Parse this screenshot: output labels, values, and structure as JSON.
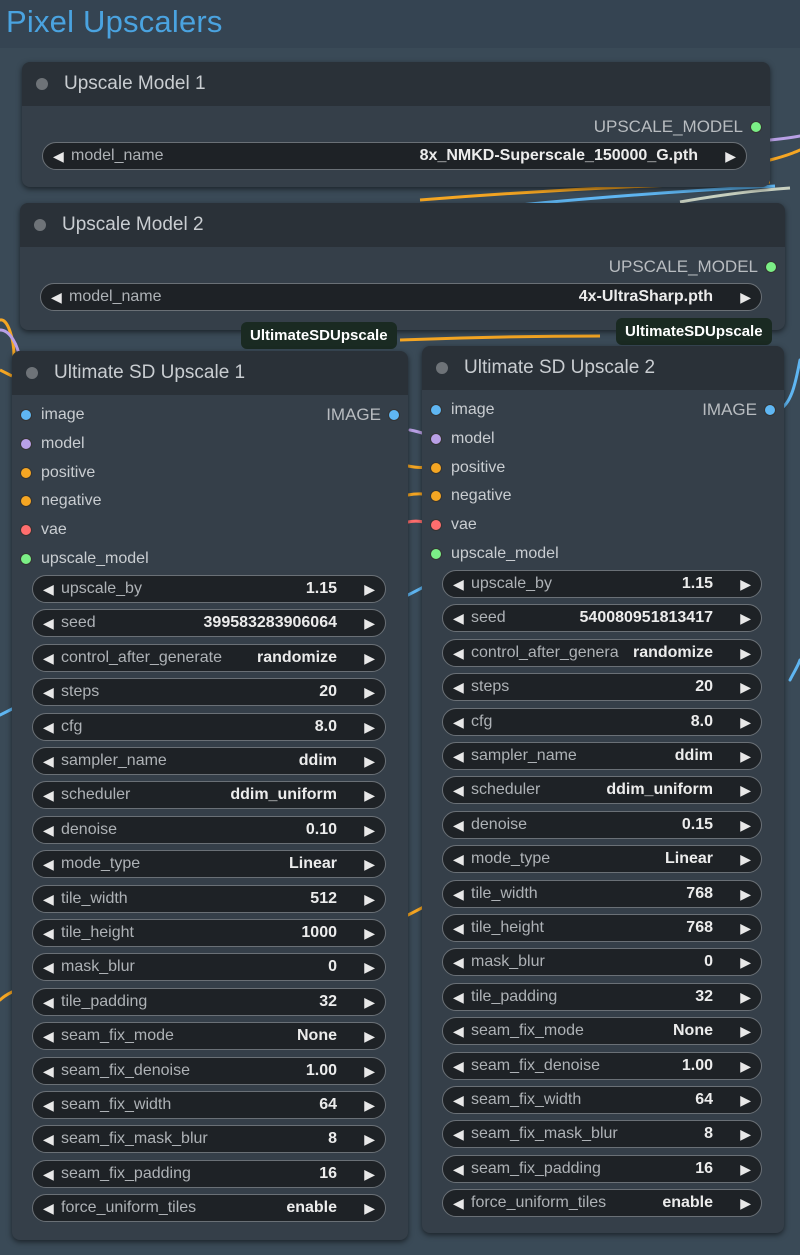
{
  "group": {
    "title": "Pixel Upscalers"
  },
  "colors": {
    "image": "#5fb6f2",
    "model": "#b9a0e6",
    "conditioning": "#f5a623",
    "vae": "#ff6e6e",
    "upscale_model": "#7bef86"
  },
  "upscale_nodes": [
    {
      "title": "Upscale Model 1",
      "output": "UPSCALE_MODEL",
      "model_label": "model_name",
      "model_value": "8x_NMKD-Superscale_150000_G.pth"
    },
    {
      "title": "Upscale Model 2",
      "output": "UPSCALE_MODEL",
      "model_label": "model_name",
      "model_value": "4x-UltraSharp.pth"
    }
  ],
  "badges": [
    "UltimateSDUpscale",
    "UltimateSDUpscale"
  ],
  "sd_nodes": [
    {
      "title": "Ultimate SD Upscale 1",
      "output": "IMAGE",
      "inputs": [
        "image",
        "model",
        "positive",
        "negative",
        "vae",
        "upscale_model"
      ],
      "widgets": [
        {
          "label": "upscale_by",
          "value": "1.15"
        },
        {
          "label": "seed",
          "value": "399583283906064"
        },
        {
          "label": "control_after_generate",
          "value": "randomize"
        },
        {
          "label": "steps",
          "value": "20"
        },
        {
          "label": "cfg",
          "value": "8.0"
        },
        {
          "label": "sampler_name",
          "value": "ddim"
        },
        {
          "label": "scheduler",
          "value": "ddim_uniform"
        },
        {
          "label": "denoise",
          "value": "0.10"
        },
        {
          "label": "mode_type",
          "value": "Linear"
        },
        {
          "label": "tile_width",
          "value": "512"
        },
        {
          "label": "tile_height",
          "value": "1000"
        },
        {
          "label": "mask_blur",
          "value": "0"
        },
        {
          "label": "tile_padding",
          "value": "32"
        },
        {
          "label": "seam_fix_mode",
          "value": "None"
        },
        {
          "label": "seam_fix_denoise",
          "value": "1.00"
        },
        {
          "label": "seam_fix_width",
          "value": "64"
        },
        {
          "label": "seam_fix_mask_blur",
          "value": "8"
        },
        {
          "label": "seam_fix_padding",
          "value": "16"
        },
        {
          "label": "force_uniform_tiles",
          "value": "enable"
        }
      ]
    },
    {
      "title": "Ultimate SD Upscale 2",
      "output": "IMAGE",
      "inputs": [
        "image",
        "model",
        "positive",
        "negative",
        "vae",
        "upscale_model"
      ],
      "widgets": [
        {
          "label": "upscale_by",
          "value": "1.15"
        },
        {
          "label": "seed",
          "value": "540080951813417"
        },
        {
          "label": "control_after_genera",
          "value": "randomize"
        },
        {
          "label": "steps",
          "value": "20"
        },
        {
          "label": "cfg",
          "value": "8.0"
        },
        {
          "label": "sampler_name",
          "value": "ddim"
        },
        {
          "label": "scheduler",
          "value": "ddim_uniform"
        },
        {
          "label": "denoise",
          "value": "0.15"
        },
        {
          "label": "mode_type",
          "value": "Linear"
        },
        {
          "label": "tile_width",
          "value": "768"
        },
        {
          "label": "tile_height",
          "value": "768"
        },
        {
          "label": "mask_blur",
          "value": "0"
        },
        {
          "label": "tile_padding",
          "value": "32"
        },
        {
          "label": "seam_fix_mode",
          "value": "None"
        },
        {
          "label": "seam_fix_denoise",
          "value": "1.00"
        },
        {
          "label": "seam_fix_width",
          "value": "64"
        },
        {
          "label": "seam_fix_mask_blur",
          "value": "8"
        },
        {
          "label": "seam_fix_padding",
          "value": "16"
        },
        {
          "label": "force_uniform_tiles",
          "value": "enable"
        }
      ]
    }
  ]
}
